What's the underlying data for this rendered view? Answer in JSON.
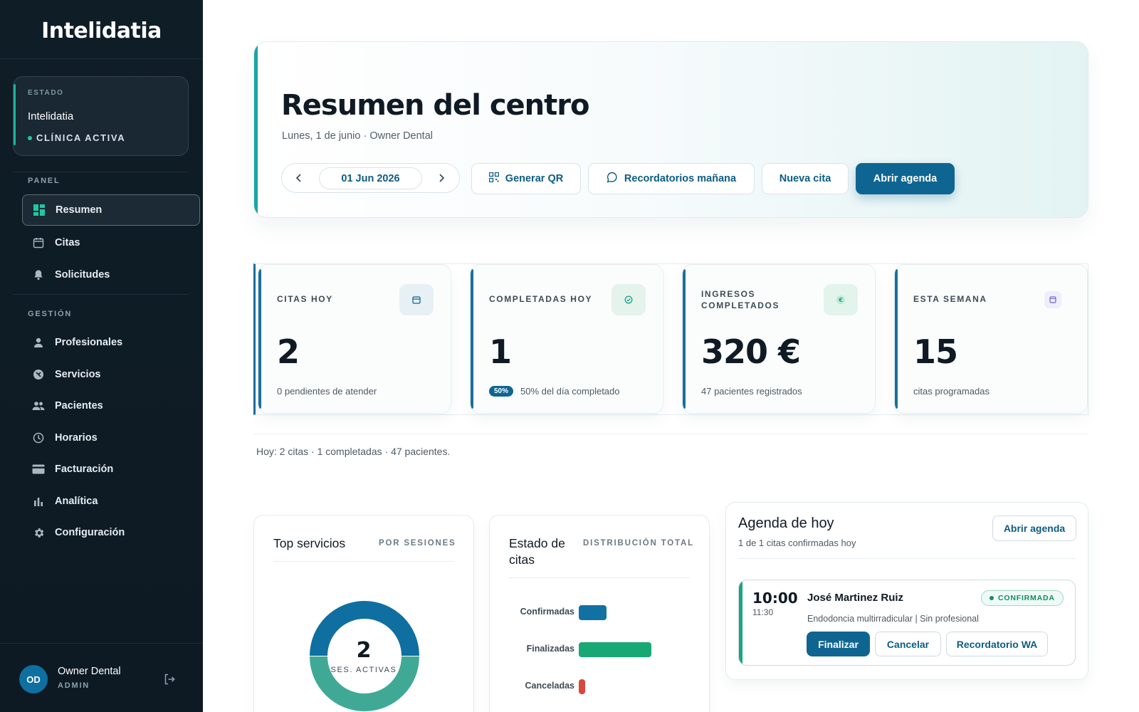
{
  "sidebar": {
    "brand": "Intelidatia",
    "state": {
      "label": "ESTADO",
      "name": "Intelidatia",
      "status": "CLÍNICA ACTIVA"
    },
    "sections": {
      "panel": "PANEL",
      "gestion": "GESTIÓN"
    },
    "items": [
      {
        "label": "Resumen",
        "icon": "dashboard-icon",
        "active": true
      },
      {
        "label": "Citas",
        "icon": "calendar-icon"
      },
      {
        "label": "Solicitudes",
        "icon": "bell-icon"
      },
      {
        "label": "Profesionales",
        "icon": "person-icon"
      },
      {
        "label": "Servicios",
        "icon": "services-icon"
      },
      {
        "label": "Pacientes",
        "icon": "patients-icon"
      },
      {
        "label": "Horarios",
        "icon": "clock-icon"
      },
      {
        "label": "Facturación",
        "icon": "card-icon"
      },
      {
        "label": "Analítica",
        "icon": "bar-chart-icon"
      },
      {
        "label": "Configuración",
        "icon": "gear-icon"
      }
    ],
    "user": {
      "initials": "OD",
      "name": "Owner Dental",
      "role": "ADMIN"
    }
  },
  "header": {
    "title": "Resumen del centro",
    "subtitle": "Lunes, 1 de junio · Owner Dental",
    "date": "01 Jun 2026",
    "buttons": {
      "qr": "Generar QR",
      "reminders": "Recordatorios mañana",
      "new": "Nueva cita",
      "open": "Abrir agenda"
    }
  },
  "stats": [
    {
      "label": "CITAS HOY",
      "value": "2",
      "foot": "0 pendientes de atender",
      "icon": "calendar-icon",
      "icon_bg": "#e7f0f5",
      "icon_color": "#0f6592"
    },
    {
      "label": "COMPLETADAS HOY",
      "value": "1",
      "badge": "50%",
      "foot": "50% del día completado",
      "icon": "check-icon",
      "icon_bg": "#e4f3ec",
      "icon_color": "#1aa584"
    },
    {
      "label": "INGRESOS COMPLETADOS",
      "value": "320 €",
      "foot": "47 pacientes registrados",
      "icon": "euro-icon",
      "icon_bg": "#e2f4ec",
      "icon_color": "#1aa584"
    },
    {
      "label": "ESTA SEMANA",
      "value": "15",
      "foot": "citas programadas",
      "icon": "calendar-icon",
      "icon_bg": "#efeefb",
      "icon_color": "#6b63c7"
    }
  ],
  "summary": "Hoy: 2 citas · 1 completadas · 47 pacientes.",
  "top_services": {
    "title": "Top servicios",
    "tag": "POR SESIONES",
    "center_value": "2",
    "center_label": "SES. ACTIVAS",
    "colors": [
      "#0f6fa0",
      "#3fa996"
    ]
  },
  "status_panel": {
    "title": "Estado de citas",
    "tag": "DISTRIBUCIÓN TOTAL"
  },
  "chart_data": {
    "type": "bar",
    "categories": [
      "Confirmadas",
      "Finalizadas",
      "Canceladas"
    ],
    "values": [
      0.38,
      1.0,
      0.09
    ],
    "colors": [
      "#1271a3",
      "#18a873",
      "#d9473f"
    ]
  },
  "agenda": {
    "title": "Agenda de hoy",
    "subtitle": "1 de 1 citas confirmadas hoy",
    "open": "Abrir agenda",
    "appointment": {
      "start": "10:00",
      "end": "11:30",
      "patient": "José Martinez Ruiz",
      "description": "Endodoncia multirradicular | Sin profesional",
      "status": "CONFIRMADA",
      "actions": {
        "finish": "Finalizar",
        "cancel": "Cancelar",
        "remind": "Recordatorio WA"
      }
    }
  }
}
